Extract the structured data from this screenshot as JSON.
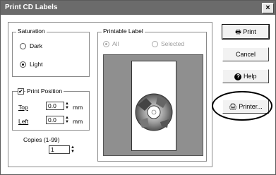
{
  "window": {
    "title": "Print CD Labels",
    "close": "×"
  },
  "saturation": {
    "legend": "Saturation",
    "dark": "Dark",
    "light": "Light"
  },
  "print_position": {
    "legend": "Print Position",
    "top_label": "Top",
    "top_value": "0.0",
    "left_label": "Left",
    "left_value": "0.0",
    "unit": "mm"
  },
  "copies": {
    "label": "Copies (1-99)",
    "value": "1"
  },
  "printable_label": {
    "legend": "Printable Label",
    "all": "All",
    "selected": "Selected"
  },
  "buttons": {
    "print": "Print",
    "cancel": "Cancel",
    "help": "Help",
    "printer": "Printer..."
  }
}
